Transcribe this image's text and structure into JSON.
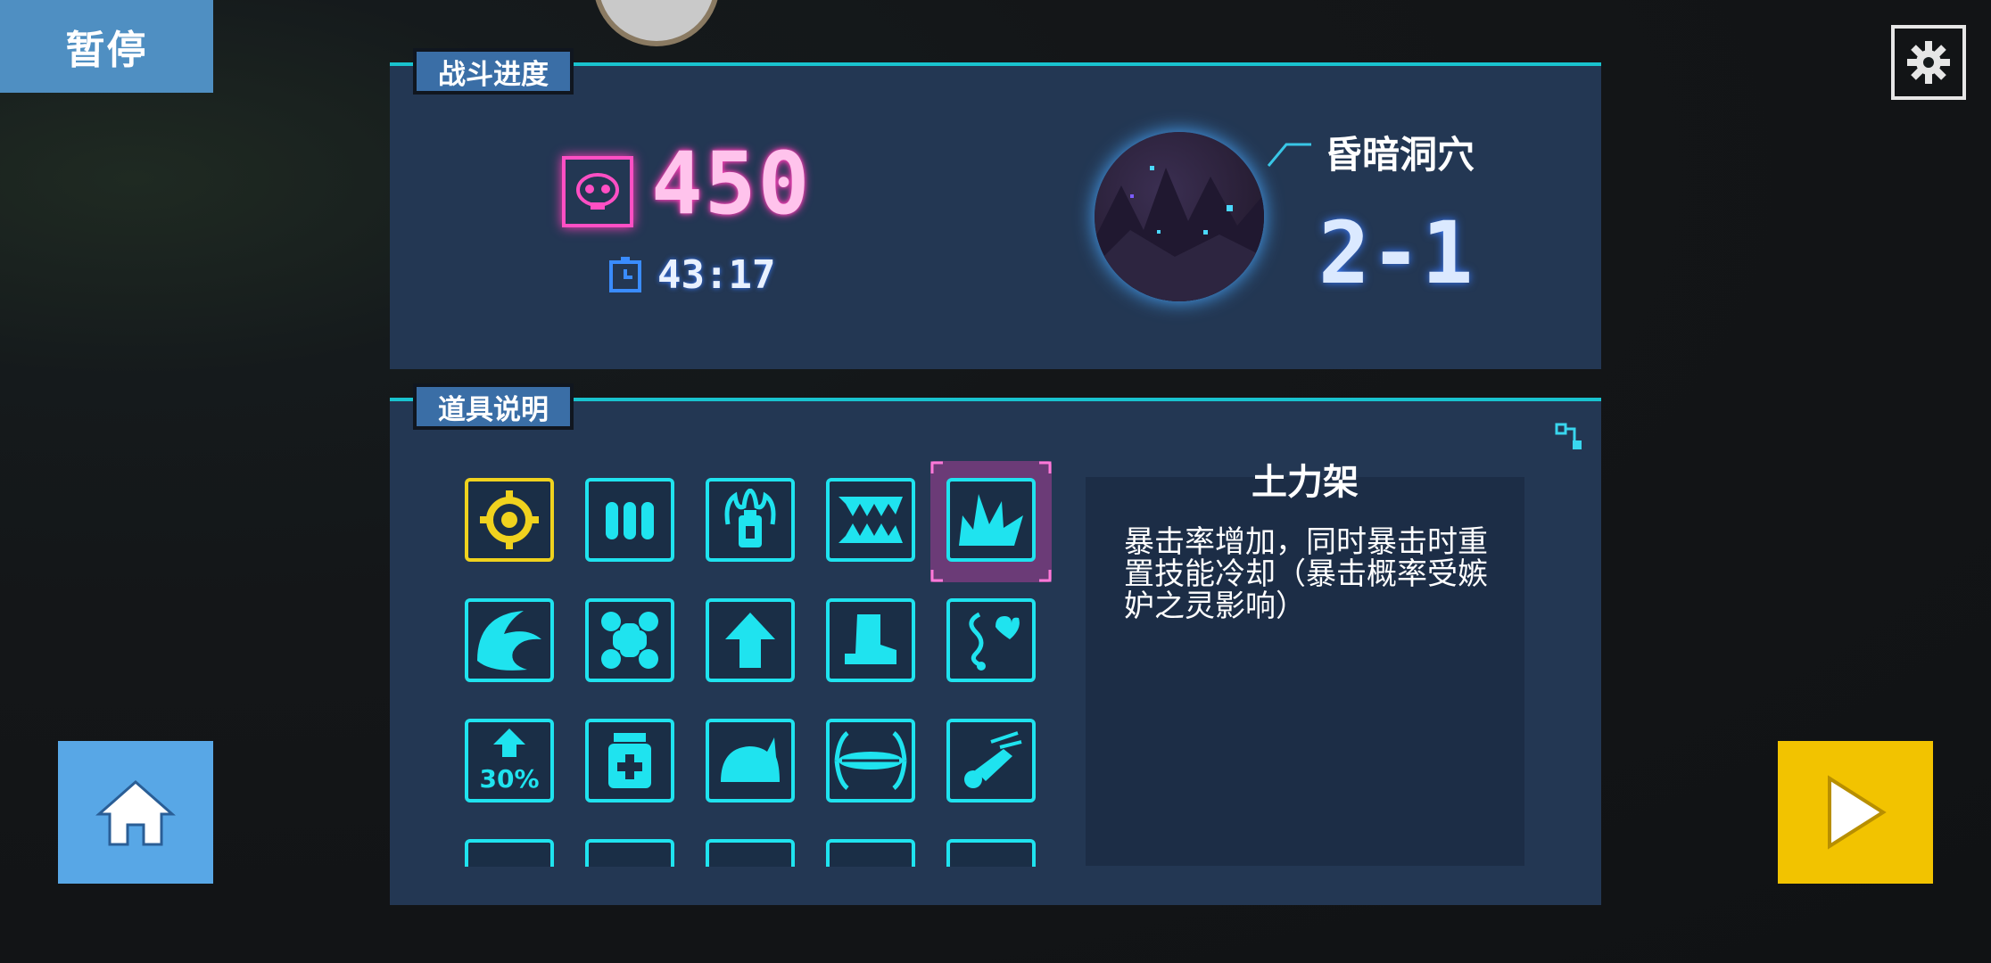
{
  "header": {
    "pause_label": "暂停"
  },
  "battle_progress": {
    "tab_label": "战斗进度",
    "kill_count": "450",
    "timer": "43:17",
    "stage_name": "昏暗洞穴",
    "stage_number": "2-1"
  },
  "items_panel": {
    "tab_label": "道具说明",
    "items": [
      {
        "icon": "target-icon",
        "color": "yellow"
      },
      {
        "icon": "bullets-icon",
        "color": "cyan"
      },
      {
        "icon": "flask-icon",
        "color": "cyan"
      },
      {
        "icon": "fangs-icon",
        "color": "cyan"
      },
      {
        "icon": "crit-burst-icon",
        "color": "cyan",
        "selected": true
      },
      {
        "icon": "wave-icon",
        "color": "cyan"
      },
      {
        "icon": "bone-icon",
        "color": "cyan"
      },
      {
        "icon": "arrow-up-icon",
        "color": "cyan"
      },
      {
        "icon": "boot-icon",
        "color": "cyan"
      },
      {
        "icon": "heart-vine-icon",
        "color": "cyan"
      },
      {
        "icon": "percent-up-icon",
        "color": "cyan",
        "label": "30%"
      },
      {
        "icon": "medkit-icon",
        "color": "cyan"
      },
      {
        "icon": "helmet-icon",
        "color": "cyan"
      },
      {
        "icon": "trap-icon",
        "color": "cyan"
      },
      {
        "icon": "projectile-icon",
        "color": "cyan"
      }
    ],
    "selected_item": {
      "name": "土力架",
      "description": "暴击率增加，同时暴击时重置技能冷却（暴击概率受嫉妒之灵影响）"
    }
  },
  "colors": {
    "accent": "#19c3cf",
    "panel": "#233753",
    "kill_pink": "#ff3fb8",
    "next_yellow": "#f2c300",
    "home_blue": "#58a7e6"
  }
}
